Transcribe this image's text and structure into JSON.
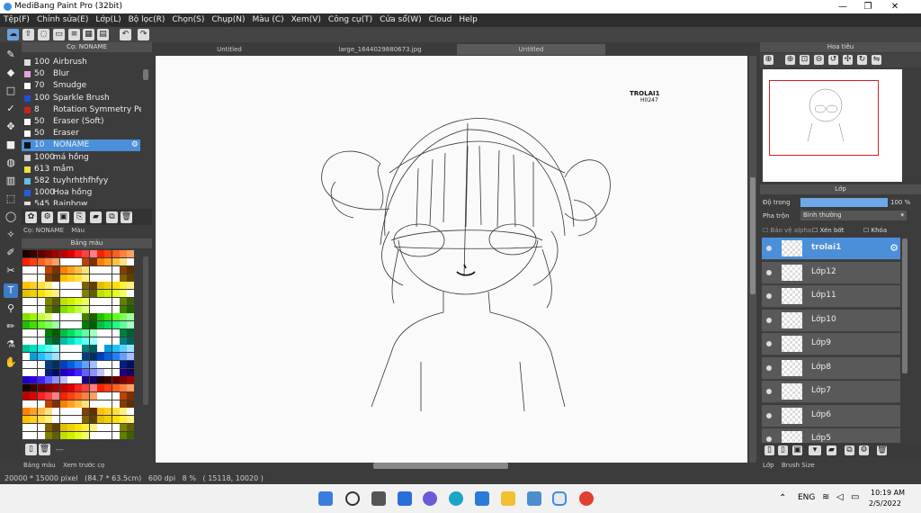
{
  "app": {
    "title": "MediBang Paint Pro (32bit)"
  },
  "menu": [
    "Tệp(F)",
    "Chỉnh sửa(E)",
    "Lớp(L)",
    "Bộ lọc(R)",
    "Chọn(S)",
    "Chụp(N)",
    "Màu (C)",
    "Xem(V)",
    "Công cụ(T)",
    "Cửa sổ(W)",
    "Cloud",
    "Help"
  ],
  "brush_panel": {
    "title": "Cọ: NONAME",
    "items": [
      {
        "size": "100",
        "name": "Airbrush",
        "color": "#dddddd"
      },
      {
        "size": "50",
        "name": "Blur",
        "color": "#e8a0e0"
      },
      {
        "size": "70",
        "name": "Smudge",
        "color": "#ffffff"
      },
      {
        "size": "100",
        "name": "Sparkle Brush",
        "color": "#2050d0"
      },
      {
        "size": "8",
        "name": "Rotation Symmetry Pen",
        "color": "#d02020"
      },
      {
        "size": "50",
        "name": "Eraser (Soft)",
        "color": "#ffffff"
      },
      {
        "size": "50",
        "name": "Eraser",
        "color": "#ffffff"
      },
      {
        "size": "10",
        "name": "NONAME",
        "color": "#111111"
      },
      {
        "size": "1000",
        "name": "má hồng",
        "color": "#cccccc"
      },
      {
        "size": "613",
        "name": "mắm",
        "color": "#f0e040"
      },
      {
        "size": "582",
        "name": "tuyhrhthfhfyy",
        "color": "#60c0f0"
      },
      {
        "size": "1000",
        "name": "Hoa hồng",
        "color": "#2060e0"
      },
      {
        "size": "545",
        "name": "Rainbow",
        "color": "#dddddd"
      }
    ],
    "tabs": [
      "Cọ: NONAME",
      "Màu"
    ]
  },
  "color_panel": {
    "title": "Bảng màu",
    "footer": "---",
    "tabs": [
      "Bảng màu",
      "Xem trước cọ"
    ]
  },
  "doc_tabs": [
    "Untitled",
    "large_1644029880673.jpg",
    "Untitled"
  ],
  "canvas": {
    "label_line1": "TROLAI1",
    "label_line2": "H0247"
  },
  "navigator": {
    "title": "Hoa tiêu"
  },
  "layer_panel": {
    "title": "Lớp",
    "opacity_label": "Độ trong",
    "opacity_value": "100 %",
    "blend_label": "Pha trộn",
    "blend_value": "Bình thường",
    "alpha_label": "Bảo vệ alpha",
    "clip_label": "Xén bớt",
    "lock_label": "Khóa",
    "layers": [
      "trolai1",
      "Lớp12",
      "Lớp11",
      "Lớp10",
      "Lớp9",
      "Lớp8",
      "Lớp7",
      "Lớp6",
      "Lớp5"
    ],
    "tabs": [
      "Lớp",
      "Brush Size"
    ]
  },
  "status": {
    "text": "20000 * 15000 pixel   (84.7 * 63.5cm)   600 dpi   8 %   ( 15118, 10020 )"
  },
  "taskbar": {
    "lang": "ENG",
    "time": "10:19 AM",
    "date": "2/5/2022"
  }
}
